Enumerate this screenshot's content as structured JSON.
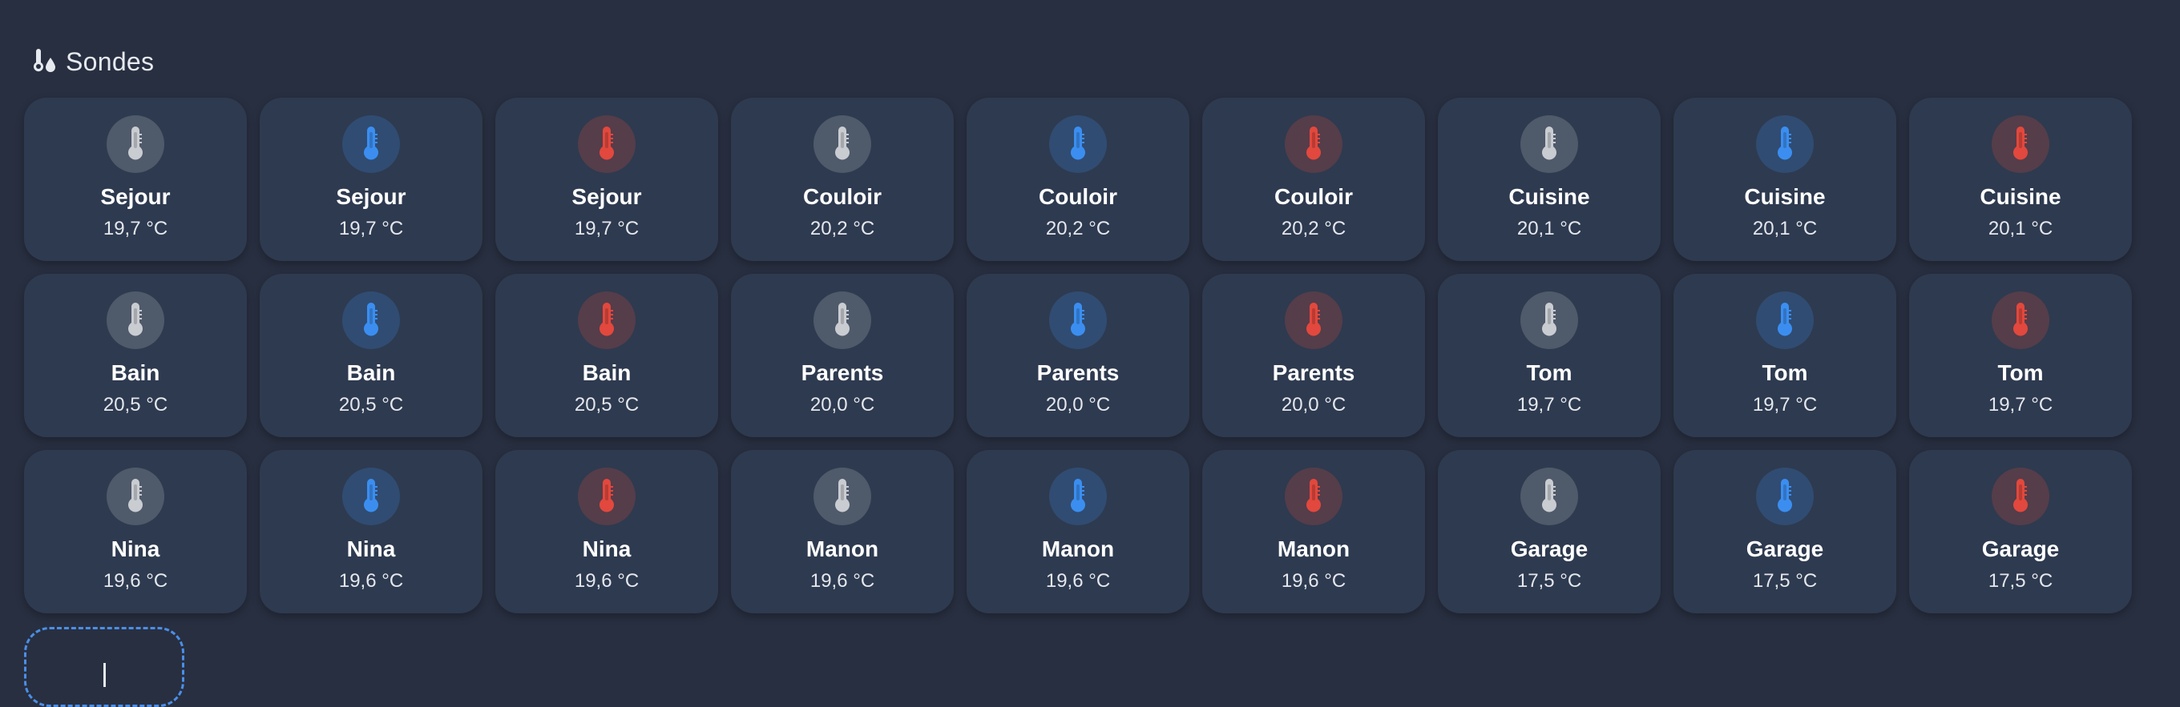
{
  "section": {
    "title": "Sondes",
    "icon": "thermometer-water-icon"
  },
  "colors": {
    "background": "#282f40",
    "tile": "#2e3a4f",
    "gray": "#c9ccd1",
    "blue": "#3b8ef0",
    "red": "#e2483d",
    "add_border": "#4a8fe8"
  },
  "tiles": [
    {
      "name": "Sejour",
      "value": "19,7 °C",
      "color": "gray"
    },
    {
      "name": "Sejour",
      "value": "19,7 °C",
      "color": "blue"
    },
    {
      "name": "Sejour",
      "value": "19,7 °C",
      "color": "red"
    },
    {
      "name": "Couloir",
      "value": "20,2 °C",
      "color": "gray"
    },
    {
      "name": "Couloir",
      "value": "20,2 °C",
      "color": "blue"
    },
    {
      "name": "Couloir",
      "value": "20,2 °C",
      "color": "red"
    },
    {
      "name": "Cuisine",
      "value": "20,1 °C",
      "color": "gray"
    },
    {
      "name": "Cuisine",
      "value": "20,1 °C",
      "color": "blue"
    },
    {
      "name": "Cuisine",
      "value": "20,1 °C",
      "color": "red"
    },
    {
      "name": "Bain",
      "value": "20,5 °C",
      "color": "gray"
    },
    {
      "name": "Bain",
      "value": "20,5 °C",
      "color": "blue"
    },
    {
      "name": "Bain",
      "value": "20,5 °C",
      "color": "red"
    },
    {
      "name": "Parents",
      "value": "20,0 °C",
      "color": "gray"
    },
    {
      "name": "Parents",
      "value": "20,0 °C",
      "color": "blue"
    },
    {
      "name": "Parents",
      "value": "20,0 °C",
      "color": "red"
    },
    {
      "name": "Tom",
      "value": "19,7 °C",
      "color": "gray"
    },
    {
      "name": "Tom",
      "value": "19,7 °C",
      "color": "blue"
    },
    {
      "name": "Tom",
      "value": "19,7 °C",
      "color": "red"
    },
    {
      "name": "Nina",
      "value": "19,6 °C",
      "color": "gray"
    },
    {
      "name": "Nina",
      "value": "19,6 °C",
      "color": "blue"
    },
    {
      "name": "Nina",
      "value": "19,6 °C",
      "color": "red"
    },
    {
      "name": "Manon",
      "value": "19,6 °C",
      "color": "gray"
    },
    {
      "name": "Manon",
      "value": "19,6 °C",
      "color": "blue"
    },
    {
      "name": "Manon",
      "value": "19,6 °C",
      "color": "red"
    },
    {
      "name": "Garage",
      "value": "17,5 °C",
      "color": "gray"
    },
    {
      "name": "Garage",
      "value": "17,5 °C",
      "color": "blue"
    },
    {
      "name": "Garage",
      "value": "17,5 °C",
      "color": "red"
    }
  ],
  "add_card": {
    "icon": "plus-icon"
  }
}
